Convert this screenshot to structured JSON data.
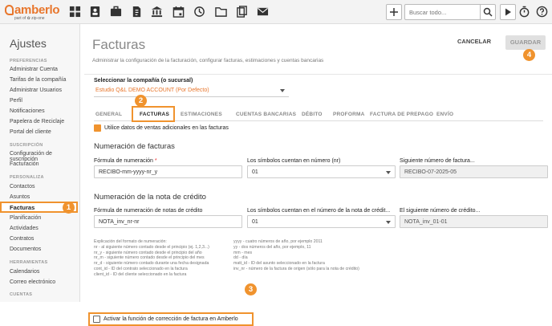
{
  "topbar": {
    "brand": "amberlo",
    "brand_sub": "part of ✿ zip-one",
    "search_placeholder": "Buscar todo...",
    "icons": [
      "dashboard-icon",
      "contacts-icon",
      "matters-icon",
      "documents-icon",
      "bank-icon",
      "calendar-icon",
      "history-icon",
      "folder-icon",
      "files-icon",
      "mail-icon",
      "add-icon",
      "search-icon",
      "play-icon",
      "timer-icon",
      "help-icon"
    ]
  },
  "sidebar": {
    "title": "Ajustes",
    "sections": [
      {
        "label": "PREFERENCIAS",
        "items": [
          "Administrar Cuenta",
          "Tarifas de la compañía",
          "Administrar Usuarios",
          "Perfil",
          "Notificaciones",
          "Papelera de Reciclaje",
          "Portal del cliente"
        ]
      },
      {
        "label": "SUSCRIPCIÓN",
        "items": [
          "Configuración de suscripción",
          "Facturación"
        ]
      },
      {
        "label": "PERSONALIZA",
        "items": [
          "Contactos",
          "Asuntos",
          "Facturas",
          "Planificación",
          "Actividades",
          "Contratos",
          "Documentos"
        ]
      },
      {
        "label": "HERRAMIENTAS",
        "items": [
          "Calendarios",
          "Correo electrónico"
        ]
      },
      {
        "label": "CUENTAS",
        "items": []
      }
    ]
  },
  "main": {
    "title": "Facturas",
    "subtitle": "Administrar la configuración de la facturación, configurar facturas, estimaciones y cuentas bancarias",
    "cancel_label": "CANCELAR",
    "save_label": "GUARDAR",
    "company_label": "Seleccionar la compañía (o sucursal)",
    "company_value": "Estudio Q&L DEMO ACCOUNT (Por Defecto)",
    "tabs": [
      "GENERAL",
      "FACTURAS",
      "ESTIMACIONES",
      "CUENTAS BANCARIAS",
      "DÉBITO",
      "PROFORMA",
      "FACTURA DE PREPAGO",
      "ENVÍO"
    ],
    "active_tab": "FACTURAS",
    "use_sales_data_label": "Utilice datos de ventas adicionales en las facturas",
    "invoice_numbering": {
      "heading": "Numeración de facturas",
      "formula_label": "Fórmula de numeración",
      "required_mark": "*",
      "formula_value": "RECIBO-mm-yyyy-nr_y",
      "digits_label": "Los símbolos cuentan en número (nr)",
      "digits_value": "01",
      "next_label": "Siguiente número de factura...",
      "next_value": "RECIBO-07-2025-05"
    },
    "credit_note": {
      "heading": "Numeración de la nota de crédito",
      "formula_label": "Fórmula de numeración de notas de crédito",
      "formula_value": "NOTA_inv_nr-nr",
      "digits_label": "Los símbolos cuentan en el número de la nota de crédit...",
      "digits_value": "01",
      "next_label": "El siguiente número de crédito...",
      "next_value": "NOTA_inv_01-01"
    },
    "help_left": [
      "Explicación del formato de numeración:",
      "nr - al siguiente número contado desde el principio (ej. 1,2,3...)",
      "nr_y - siguiente número contado desde el principio del año",
      "nr_m - siguiente número contado desde el principio del mes",
      "nr_d - siguiente número contado durante una fecha designada",
      "cont_id - ID del contrato seleccionado en la factura",
      "client_id - ID del cliente seleccionado en la factura"
    ],
    "help_right": [
      "yyyy - cuatro números de año, por ejemplo 2011",
      "yy - dos números del año, por ejemplo, 11",
      "mm - mes",
      "dd - día",
      "matt_id - ID del asunto seleccionado en la factura",
      "inv_nr - número de la factura de origen (sólo para la nota de crédito)"
    ],
    "correction_label": "Activar la función de corrección de factura en Amberlo"
  },
  "markers": [
    "1",
    "2",
    "3",
    "4"
  ],
  "colors": {
    "accent": "#f0932e",
    "brand": "#e8762c"
  }
}
